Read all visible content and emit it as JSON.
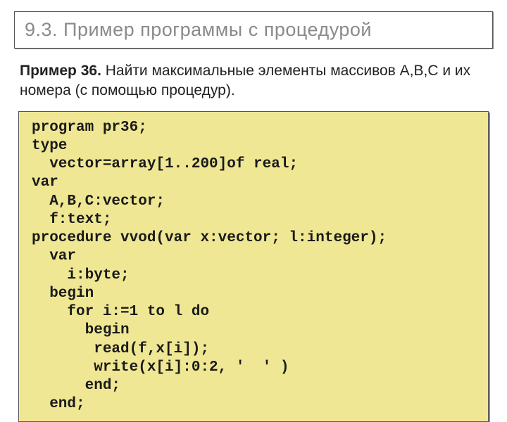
{
  "title": "9.3. Пример  программы с процедурой",
  "description_html": "<b>Пример 36.</b>  Найти максимальные элементы массивов А,В,С и их номера (с помощью процедур).",
  "code": "program pr36;\ntype\n  vector=array[1..200]of real;\nvar\n  A,B,C:vector;\n  f:text;\nprocedure vvod(var x:vector; l:integer);\n  var\n    i:byte;\n  begin\n    for i:=1 to l do\n      begin\n       read(f,x[i]);\n       write(x[i]:0:2, '  ' )\n      end;\n  end;"
}
